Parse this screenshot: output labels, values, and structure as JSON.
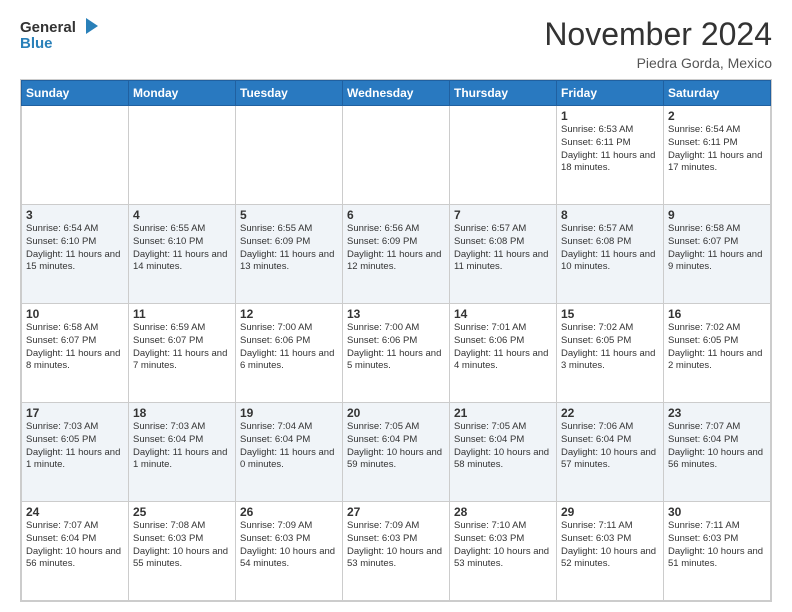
{
  "header": {
    "logo_general": "General",
    "logo_blue": "Blue",
    "month_title": "November 2024",
    "location": "Piedra Gorda, Mexico"
  },
  "weekdays": [
    "Sunday",
    "Monday",
    "Tuesday",
    "Wednesday",
    "Thursday",
    "Friday",
    "Saturday"
  ],
  "weeks": [
    [
      {
        "day": "",
        "info": ""
      },
      {
        "day": "",
        "info": ""
      },
      {
        "day": "",
        "info": ""
      },
      {
        "day": "",
        "info": ""
      },
      {
        "day": "",
        "info": ""
      },
      {
        "day": "1",
        "info": "Sunrise: 6:53 AM\nSunset: 6:11 PM\nDaylight: 11 hours and 18 minutes."
      },
      {
        "day": "2",
        "info": "Sunrise: 6:54 AM\nSunset: 6:11 PM\nDaylight: 11 hours and 17 minutes."
      }
    ],
    [
      {
        "day": "3",
        "info": "Sunrise: 6:54 AM\nSunset: 6:10 PM\nDaylight: 11 hours and 15 minutes."
      },
      {
        "day": "4",
        "info": "Sunrise: 6:55 AM\nSunset: 6:10 PM\nDaylight: 11 hours and 14 minutes."
      },
      {
        "day": "5",
        "info": "Sunrise: 6:55 AM\nSunset: 6:09 PM\nDaylight: 11 hours and 13 minutes."
      },
      {
        "day": "6",
        "info": "Sunrise: 6:56 AM\nSunset: 6:09 PM\nDaylight: 11 hours and 12 minutes."
      },
      {
        "day": "7",
        "info": "Sunrise: 6:57 AM\nSunset: 6:08 PM\nDaylight: 11 hours and 11 minutes."
      },
      {
        "day": "8",
        "info": "Sunrise: 6:57 AM\nSunset: 6:08 PM\nDaylight: 11 hours and 10 minutes."
      },
      {
        "day": "9",
        "info": "Sunrise: 6:58 AM\nSunset: 6:07 PM\nDaylight: 11 hours and 9 minutes."
      }
    ],
    [
      {
        "day": "10",
        "info": "Sunrise: 6:58 AM\nSunset: 6:07 PM\nDaylight: 11 hours and 8 minutes."
      },
      {
        "day": "11",
        "info": "Sunrise: 6:59 AM\nSunset: 6:07 PM\nDaylight: 11 hours and 7 minutes."
      },
      {
        "day": "12",
        "info": "Sunrise: 7:00 AM\nSunset: 6:06 PM\nDaylight: 11 hours and 6 minutes."
      },
      {
        "day": "13",
        "info": "Sunrise: 7:00 AM\nSunset: 6:06 PM\nDaylight: 11 hours and 5 minutes."
      },
      {
        "day": "14",
        "info": "Sunrise: 7:01 AM\nSunset: 6:06 PM\nDaylight: 11 hours and 4 minutes."
      },
      {
        "day": "15",
        "info": "Sunrise: 7:02 AM\nSunset: 6:05 PM\nDaylight: 11 hours and 3 minutes."
      },
      {
        "day": "16",
        "info": "Sunrise: 7:02 AM\nSunset: 6:05 PM\nDaylight: 11 hours and 2 minutes."
      }
    ],
    [
      {
        "day": "17",
        "info": "Sunrise: 7:03 AM\nSunset: 6:05 PM\nDaylight: 11 hours and 1 minute."
      },
      {
        "day": "18",
        "info": "Sunrise: 7:03 AM\nSunset: 6:04 PM\nDaylight: 11 hours and 1 minute."
      },
      {
        "day": "19",
        "info": "Sunrise: 7:04 AM\nSunset: 6:04 PM\nDaylight: 11 hours and 0 minutes."
      },
      {
        "day": "20",
        "info": "Sunrise: 7:05 AM\nSunset: 6:04 PM\nDaylight: 10 hours and 59 minutes."
      },
      {
        "day": "21",
        "info": "Sunrise: 7:05 AM\nSunset: 6:04 PM\nDaylight: 10 hours and 58 minutes."
      },
      {
        "day": "22",
        "info": "Sunrise: 7:06 AM\nSunset: 6:04 PM\nDaylight: 10 hours and 57 minutes."
      },
      {
        "day": "23",
        "info": "Sunrise: 7:07 AM\nSunset: 6:04 PM\nDaylight: 10 hours and 56 minutes."
      }
    ],
    [
      {
        "day": "24",
        "info": "Sunrise: 7:07 AM\nSunset: 6:04 PM\nDaylight: 10 hours and 56 minutes."
      },
      {
        "day": "25",
        "info": "Sunrise: 7:08 AM\nSunset: 6:03 PM\nDaylight: 10 hours and 55 minutes."
      },
      {
        "day": "26",
        "info": "Sunrise: 7:09 AM\nSunset: 6:03 PM\nDaylight: 10 hours and 54 minutes."
      },
      {
        "day": "27",
        "info": "Sunrise: 7:09 AM\nSunset: 6:03 PM\nDaylight: 10 hours and 53 minutes."
      },
      {
        "day": "28",
        "info": "Sunrise: 7:10 AM\nSunset: 6:03 PM\nDaylight: 10 hours and 53 minutes."
      },
      {
        "day": "29",
        "info": "Sunrise: 7:11 AM\nSunset: 6:03 PM\nDaylight: 10 hours and 52 minutes."
      },
      {
        "day": "30",
        "info": "Sunrise: 7:11 AM\nSunset: 6:03 PM\nDaylight: 10 hours and 51 minutes."
      }
    ]
  ]
}
